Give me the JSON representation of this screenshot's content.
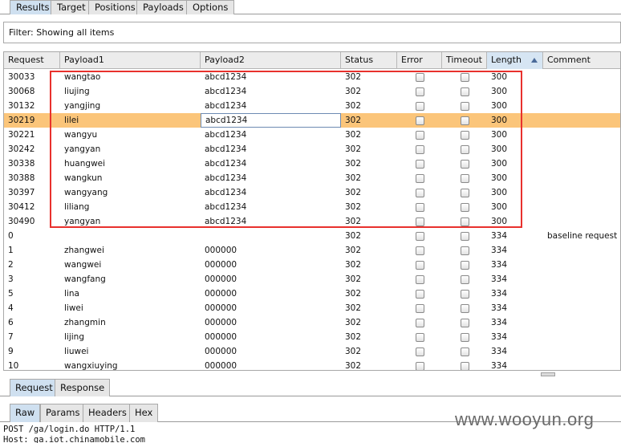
{
  "top_tabs": [
    "Results",
    "Target",
    "Positions",
    "Payloads",
    "Options"
  ],
  "filter": {
    "text": "Filter:  Showing all items"
  },
  "table": {
    "columns": [
      "Request",
      "Payload1",
      "Payload2",
      "Status",
      "Error",
      "Timeout",
      "Length",
      "Comment"
    ],
    "sorted_column": "Length",
    "rows": [
      [
        "30033",
        "wangtao",
        "abcd1234",
        "302",
        "300",
        ""
      ],
      [
        "30068",
        "liujing",
        "abcd1234",
        "302",
        "300",
        ""
      ],
      [
        "30132",
        "yangjing",
        "abcd1234",
        "302",
        "300",
        ""
      ],
      [
        "30219",
        "lilei",
        "abcd1234",
        "302",
        "300",
        ""
      ],
      [
        "30221",
        "wangyu",
        "abcd1234",
        "302",
        "300",
        ""
      ],
      [
        "30242",
        "yangyan",
        "abcd1234",
        "302",
        "300",
        ""
      ],
      [
        "30338",
        "huangwei",
        "abcd1234",
        "302",
        "300",
        ""
      ],
      [
        "30388",
        "wangkun",
        "abcd1234",
        "302",
        "300",
        ""
      ],
      [
        "30397",
        "wangyang",
        "abcd1234",
        "302",
        "300",
        ""
      ],
      [
        "30412",
        "liliang",
        "abcd1234",
        "302",
        "300",
        ""
      ],
      [
        "30490",
        "yangyan",
        "abcd1234",
        "302",
        "300",
        ""
      ],
      [
        "0",
        "",
        "",
        "302",
        "334",
        "baseline request"
      ],
      [
        "1",
        "zhangwei",
        "000000",
        "302",
        "334",
        ""
      ],
      [
        "2",
        "wangwei",
        "000000",
        "302",
        "334",
        ""
      ],
      [
        "3",
        "wangfang",
        "000000",
        "302",
        "334",
        ""
      ],
      [
        "5",
        "lina",
        "000000",
        "302",
        "334",
        ""
      ],
      [
        "4",
        "liwei",
        "000000",
        "302",
        "334",
        ""
      ],
      [
        "6",
        "zhangmin",
        "000000",
        "302",
        "334",
        ""
      ],
      [
        "7",
        "lijing",
        "000000",
        "302",
        "334",
        ""
      ],
      [
        "9",
        "liuwei",
        "000000",
        "302",
        "334",
        ""
      ],
      [
        "10",
        "wangxiuying",
        "000000",
        "302",
        "334",
        ""
      ]
    ],
    "selected_row": "30219"
  },
  "rr_tabs": [
    "Request",
    "Response"
  ],
  "sub_tabs": [
    "Raw",
    "Params",
    "Headers",
    "Hex"
  ],
  "raw_lines": [
    "POST /ga/login.do HTTP/1.1",
    "Host: ga.iot.chinamobile.com"
  ],
  "watermark": "www.wooyun.org",
  "colors": {
    "selected_row": "#fbc57a",
    "highlight_box": "#e8312d",
    "active_tab": "#cfe0f0"
  }
}
